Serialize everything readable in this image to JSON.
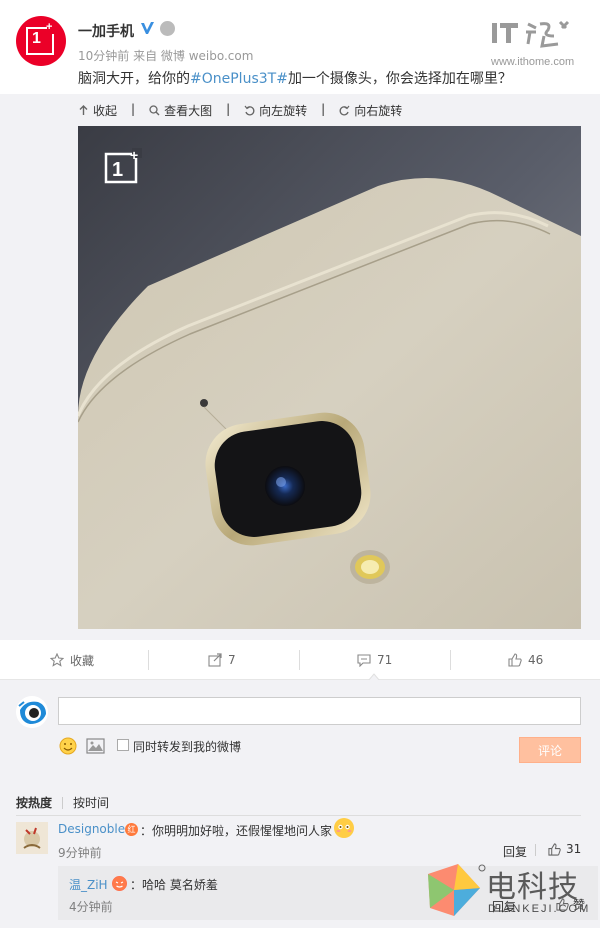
{
  "post": {
    "user_name": "一加手机",
    "meta": "10分钟前 来自 微博 weibo.com",
    "text_before": "脑洞大开，给你的",
    "hashtag": "#OnePlus3T#",
    "text_after": "加一个摄像头，你会选择加在哪里？",
    "avatar_logo": "1"
  },
  "source_logo": {
    "url": "www.ithome.com"
  },
  "media_toolbar": {
    "collapse": "收起",
    "view_large": "查看大图",
    "rotate_left": "向左旋转",
    "rotate_right": "向右旋转"
  },
  "actions": {
    "favorite": "收藏",
    "repost_count": "7",
    "comment_count": "71",
    "like_count": "46"
  },
  "composer": {
    "forward_label": "同时转发到我的微博",
    "submit_label": "评论",
    "input_value": ""
  },
  "comments": {
    "sort_hot": "按热度",
    "sort_time": "按时间",
    "items": [
      {
        "user": "Designoble",
        "badge": "红",
        "text": "：你明明加好啦，还假惺惺地问人家",
        "time": "9分钟前",
        "reply": "回复",
        "likes": "31",
        "sub": {
          "user": "温_ZiH",
          "text": "：哈哈 莫名娇羞",
          "time": "4分钟前",
          "reply": "回复",
          "likes": "赞"
        }
      }
    ]
  },
  "watermark": {
    "cn": "电科技",
    "en": "DIANKEJI.COM"
  },
  "colors": {
    "brand_red": "#eb0028",
    "link_blue": "#4a90c8",
    "submit_disabled": "#ffc09f"
  }
}
